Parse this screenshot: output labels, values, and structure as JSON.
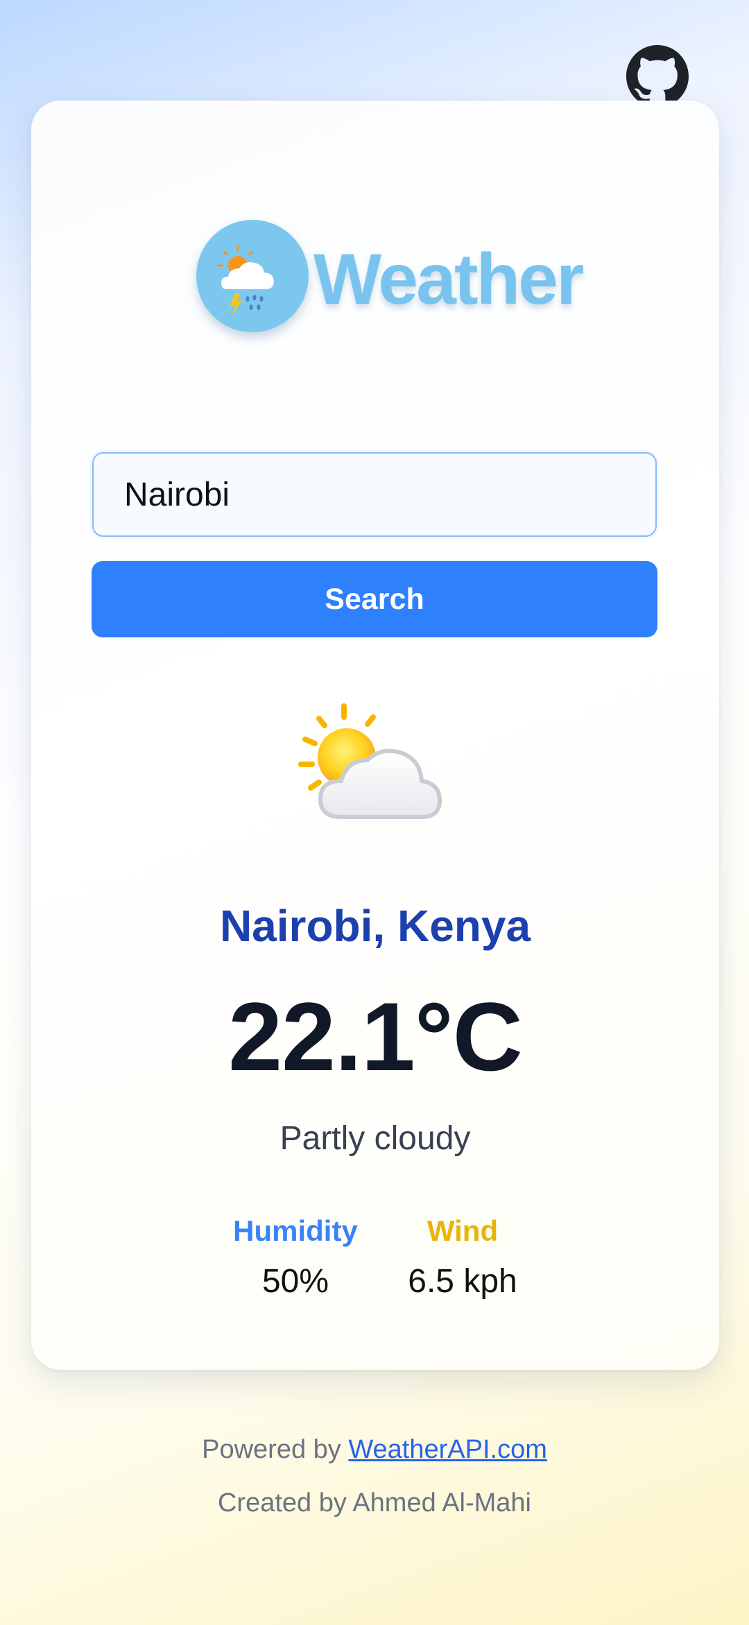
{
  "header": {
    "github_link_icon": "github-icon"
  },
  "logo": {
    "icon": "storm-cloud-sun-icon",
    "text": "Weather",
    "color": "#79c4ee"
  },
  "search": {
    "value": "Nairobi",
    "placeholder": "",
    "button_label": "Search",
    "button_color": "#2f80fc"
  },
  "weather": {
    "icon": "partly-cloudy-icon",
    "location": "Nairobi, Kenya",
    "temperature": "22.1°C",
    "condition": "Partly cloudy",
    "humidity_label": "Humidity",
    "humidity_value": "50%",
    "wind_label": "Wind",
    "wind_value": "6.5 kph"
  },
  "colors": {
    "location": "#1d40af",
    "humidity_label": "#3b82f6",
    "wind_label": "#eab308",
    "link": "#2563eb"
  },
  "footer": {
    "powered_prefix": "Powered by ",
    "powered_link": "WeatherAPI.com",
    "credit": "Created by Ahmed Al-Mahi"
  }
}
